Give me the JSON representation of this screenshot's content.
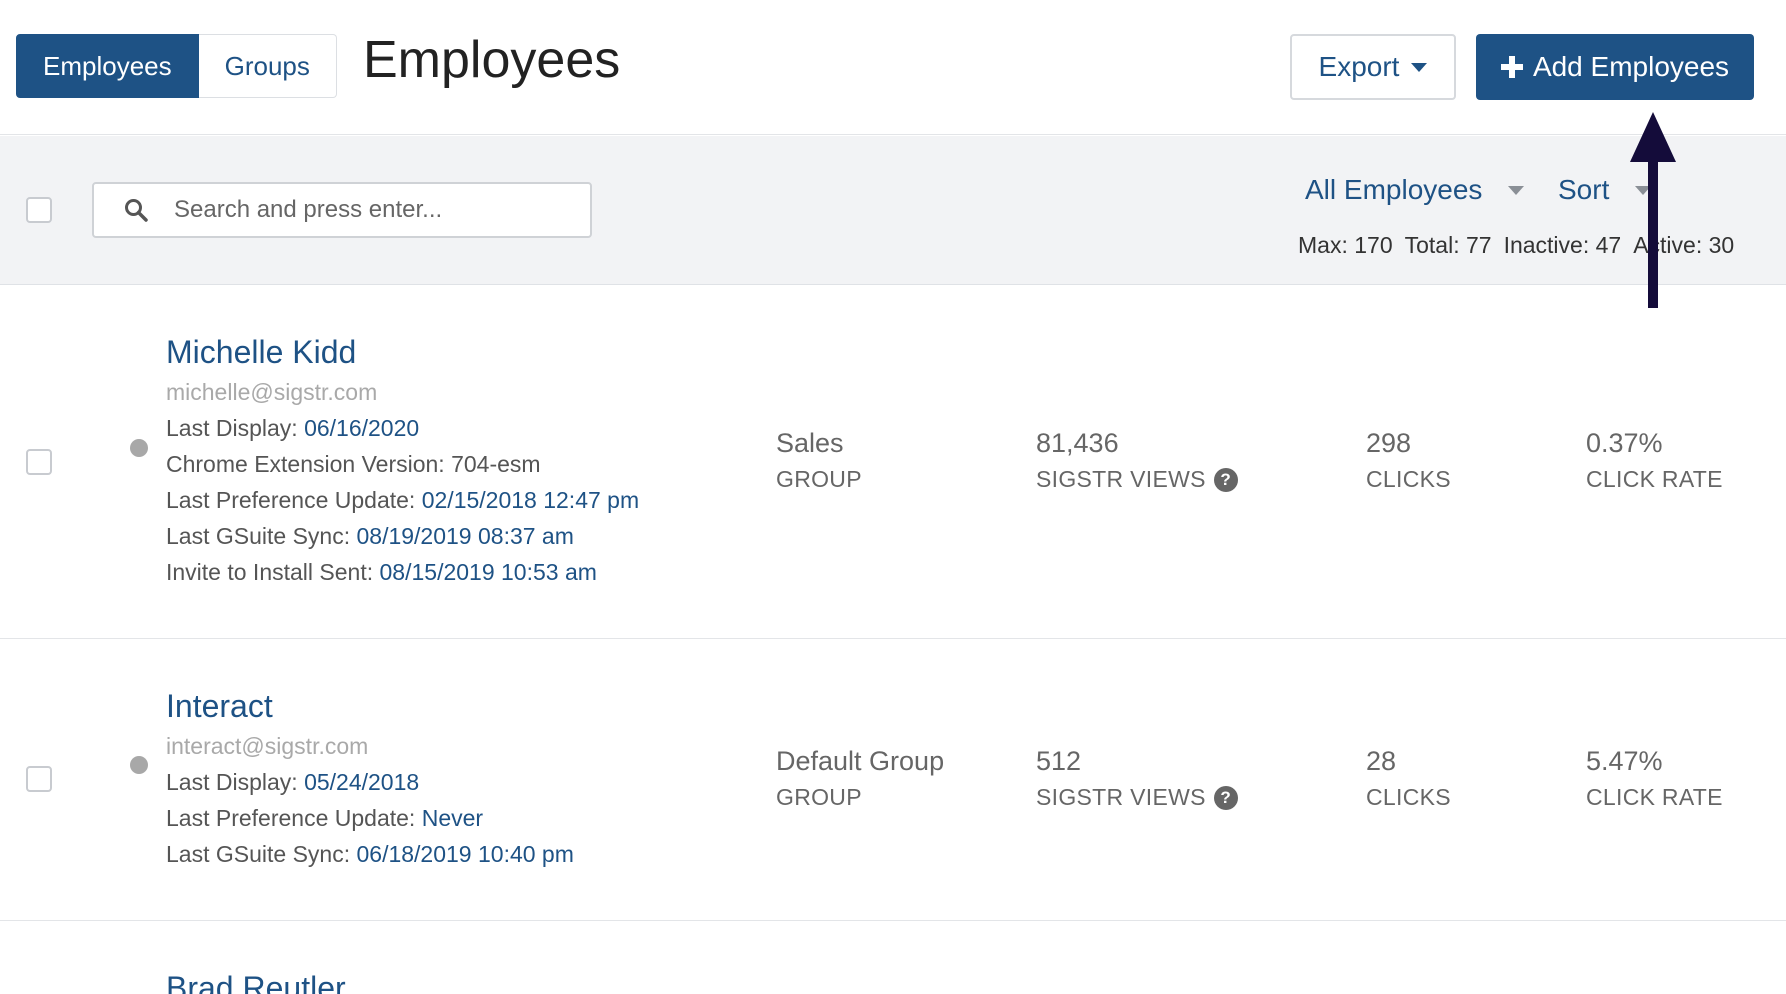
{
  "header": {
    "tabs": [
      {
        "label": "Employees",
        "active": true
      },
      {
        "label": "Groups",
        "active": false
      }
    ],
    "title": "Employees",
    "export_label": "Export",
    "add_label": "Add Employees"
  },
  "toolbar": {
    "search_placeholder": "Search and press enter...",
    "filter_label": "All Employees",
    "sort_label": "Sort",
    "stats": {
      "max": "Max: 170",
      "total": "Total: 77",
      "inactive": "Inactive: 47",
      "active": "Active: 30"
    }
  },
  "employees": [
    {
      "name": "Michelle Kidd",
      "email": "michelle@sigstr.com",
      "details": [
        {
          "label": "Last Display: ",
          "value": "06/16/2020"
        },
        {
          "label": "Chrome Extension Version: 704-esm",
          "value": ""
        },
        {
          "label": "Last Preference Update: ",
          "value": "02/15/2018 12:47 pm"
        },
        {
          "label": "Last GSuite Sync: ",
          "value": "08/19/2019 08:37 am"
        },
        {
          "label": "Invite to Install Sent: ",
          "value": "08/15/2019 10:53 am"
        }
      ],
      "group": "Sales",
      "group_label": "GROUP",
      "views": "81,436",
      "views_label": "SIGSTR VIEWS",
      "clicks": "298",
      "clicks_label": "CLICKS",
      "rate": "0.37%",
      "rate_label": "CLICK RATE"
    },
    {
      "name": "Interact",
      "email": "interact@sigstr.com",
      "details": [
        {
          "label": "Last Display: ",
          "value": "05/24/2018"
        },
        {
          "label": "Last Preference Update: ",
          "value": "Never"
        },
        {
          "label": "Last GSuite Sync: ",
          "value": "06/18/2019 10:40 pm"
        }
      ],
      "group": "Default Group",
      "group_label": "GROUP",
      "views": "512",
      "views_label": "SIGSTR VIEWS",
      "clicks": "28",
      "clicks_label": "CLICKS",
      "rate": "5.47%",
      "rate_label": "CLICK RATE"
    },
    {
      "name": "Brad Reutler"
    }
  ],
  "colors": {
    "primary": "#1e5285",
    "toolbar_bg": "#f2f3f5",
    "annotation_arrow": "#140c3a"
  },
  "icons": {
    "search": "search-icon",
    "help": "question-circle-icon",
    "plus": "plus-icon",
    "caret": "caret-down-icon"
  }
}
